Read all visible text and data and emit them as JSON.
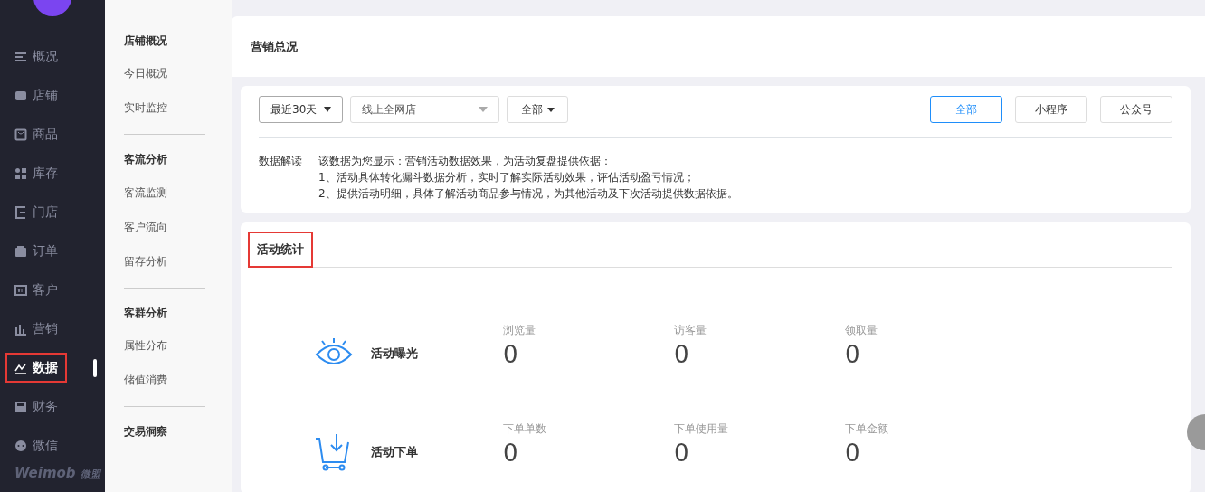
{
  "sidebar": {
    "items": [
      {
        "label": "概况",
        "selected": false,
        "highlighted": false
      },
      {
        "label": "店铺",
        "selected": false,
        "highlighted": false
      },
      {
        "label": "商品",
        "selected": false,
        "highlighted": false
      },
      {
        "label": "库存",
        "selected": false,
        "highlighted": false
      },
      {
        "label": "门店",
        "selected": false,
        "highlighted": false
      },
      {
        "label": "订单",
        "selected": false,
        "highlighted": false
      },
      {
        "label": "客户",
        "selected": false,
        "highlighted": false
      },
      {
        "label": "营销",
        "selected": false,
        "highlighted": false
      },
      {
        "label": "数据",
        "selected": true,
        "highlighted": true
      },
      {
        "label": "财务",
        "selected": false,
        "highlighted": false
      },
      {
        "label": "微信",
        "selected": false,
        "highlighted": false
      }
    ],
    "brand": "Weimob",
    "brand_cn": "微盟"
  },
  "subnav": [
    {
      "heading": "店铺概况",
      "items": [
        "今日概况",
        "实时监控"
      ]
    },
    {
      "heading": "客流分析",
      "items": [
        "客流监测",
        "客户流向",
        "留存分析"
      ]
    },
    {
      "heading": "客群分析",
      "items": [
        "属性分布",
        "储值消费"
      ]
    },
    {
      "heading": "交易洞察"
    }
  ],
  "page_title": "营销总况",
  "filters": {
    "period": "最近30天",
    "store": "线上全网店",
    "scope": "全部",
    "channels": [
      {
        "label": "全部",
        "selected": true
      },
      {
        "label": "小程序",
        "selected": false
      },
      {
        "label": "公众号",
        "selected": false
      }
    ]
  },
  "explain": {
    "label": "数据解读",
    "lines": [
      "该数据为您显示：营销活动数据效果，为活动复盘提供依据：",
      "1、活动具体转化漏斗数据分析，实时了解实际活动效果，评估活动盈亏情况；",
      "2、提供活动明细，具体了解活动商品参与情况，为其他活动及下次活动提供数据依据。"
    ]
  },
  "stats": {
    "title": "活动统计",
    "highlighted": true,
    "groups": [
      {
        "name": "活动曝光",
        "metrics": [
          {
            "label": "浏览量",
            "value": "0"
          },
          {
            "label": "访客量",
            "value": "0"
          },
          {
            "label": "领取量",
            "value": "0"
          }
        ]
      },
      {
        "name": "活动下单",
        "metrics": [
          {
            "label": "下单单数",
            "value": "0"
          },
          {
            "label": "下单使用量",
            "value": "0"
          },
          {
            "label": "下单金额",
            "value": "0"
          }
        ]
      }
    ]
  }
}
